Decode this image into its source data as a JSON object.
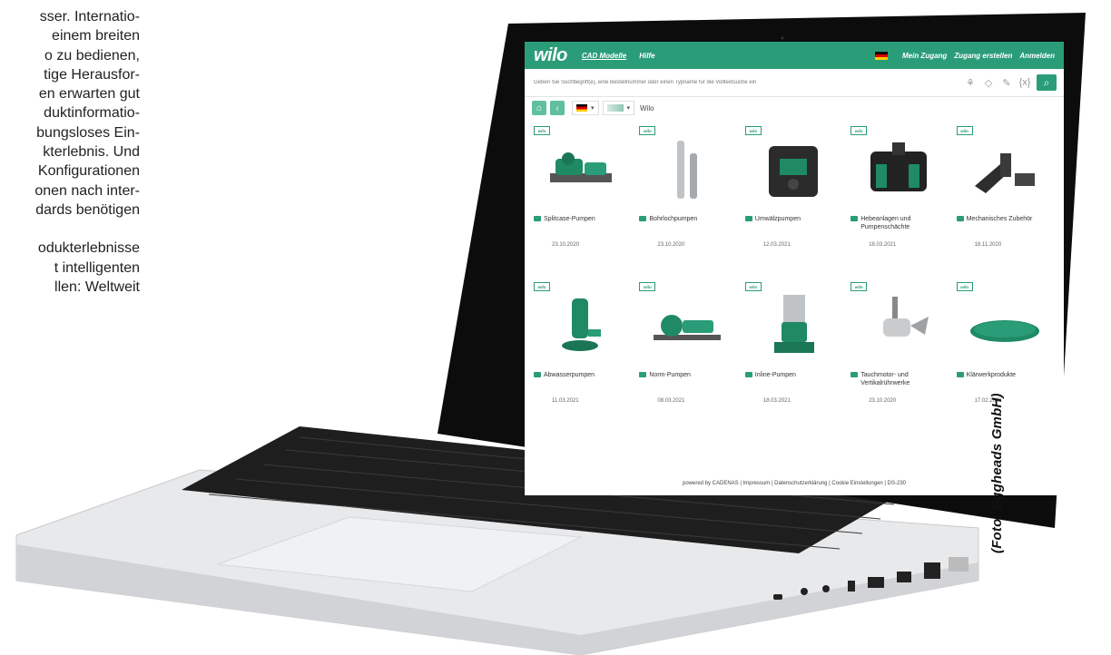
{
  "article": {
    "lines": [
      "sser. Internatio-",
      "einem breiten",
      "o zu bedienen,",
      "tige Herausfor-",
      "en erwarten gut",
      "duktinformatio-",
      "bungsloses Ein-",
      "kterlebnis. Und",
      "Konfigurationen",
      "onen nach inter-",
      "dards benötigen",
      "",
      "odukterlebnisse",
      "t intelligenten",
      "llen: Weltweit"
    ]
  },
  "credit": "(Foto: Eggheads GmbH)",
  "app": {
    "logo": "wilo",
    "nav": [
      "CAD Modelle",
      "Hilfe"
    ],
    "right_nav": [
      "Mein Zugang",
      "Zugang erstellen",
      "Anmelden"
    ],
    "search_placeholder": "Geben Sie Suchbegriff(e), eine Bestellnummer oder einen Typname für die Volltextsuche ein",
    "breadcrumb": "Wilo",
    "products": [
      {
        "name": "Splitcase-Pumpen",
        "date": "23.10.2020",
        "icon": "splitcase-pump-image"
      },
      {
        "name": "Bohrlochpumpen",
        "date": "23.10.2020",
        "icon": "borehole-pump-image"
      },
      {
        "name": "Umwälzpumpen",
        "date": "12.03.2021",
        "icon": "circulator-pump-image"
      },
      {
        "name": "Hebeanlagen und Pumpenschächte",
        "date": "18.03.2021",
        "icon": "lifting-station-image"
      },
      {
        "name": "Mechanisches Zubehör",
        "date": "18.11.2020",
        "icon": "mechanical-accessory-image"
      },
      {
        "name": "Abwasserpumpen",
        "date": "11.03.2021",
        "icon": "sewage-pump-image"
      },
      {
        "name": "Norm-Pumpen",
        "date": "08.03.2021",
        "icon": "standard-pump-image"
      },
      {
        "name": "Inline-Pumpen",
        "date": "18.03.2021",
        "icon": "inline-pump-image"
      },
      {
        "name": "Tauchmotor- und Vertikalrührwerke",
        "date": "23.10.2020",
        "icon": "submersible-mixer-image"
      },
      {
        "name": "Klärwerkprodukte",
        "date": "17.02.2021",
        "icon": "wastewater-product-image"
      }
    ],
    "badge": "wilo",
    "footer": "powered by CADENAS | Impressum | Datenschutzerklärung | Cookie Einstellungen | DS-230"
  },
  "colors": {
    "brand": "#2a9d78",
    "brand_light": "#5fbfa0"
  }
}
